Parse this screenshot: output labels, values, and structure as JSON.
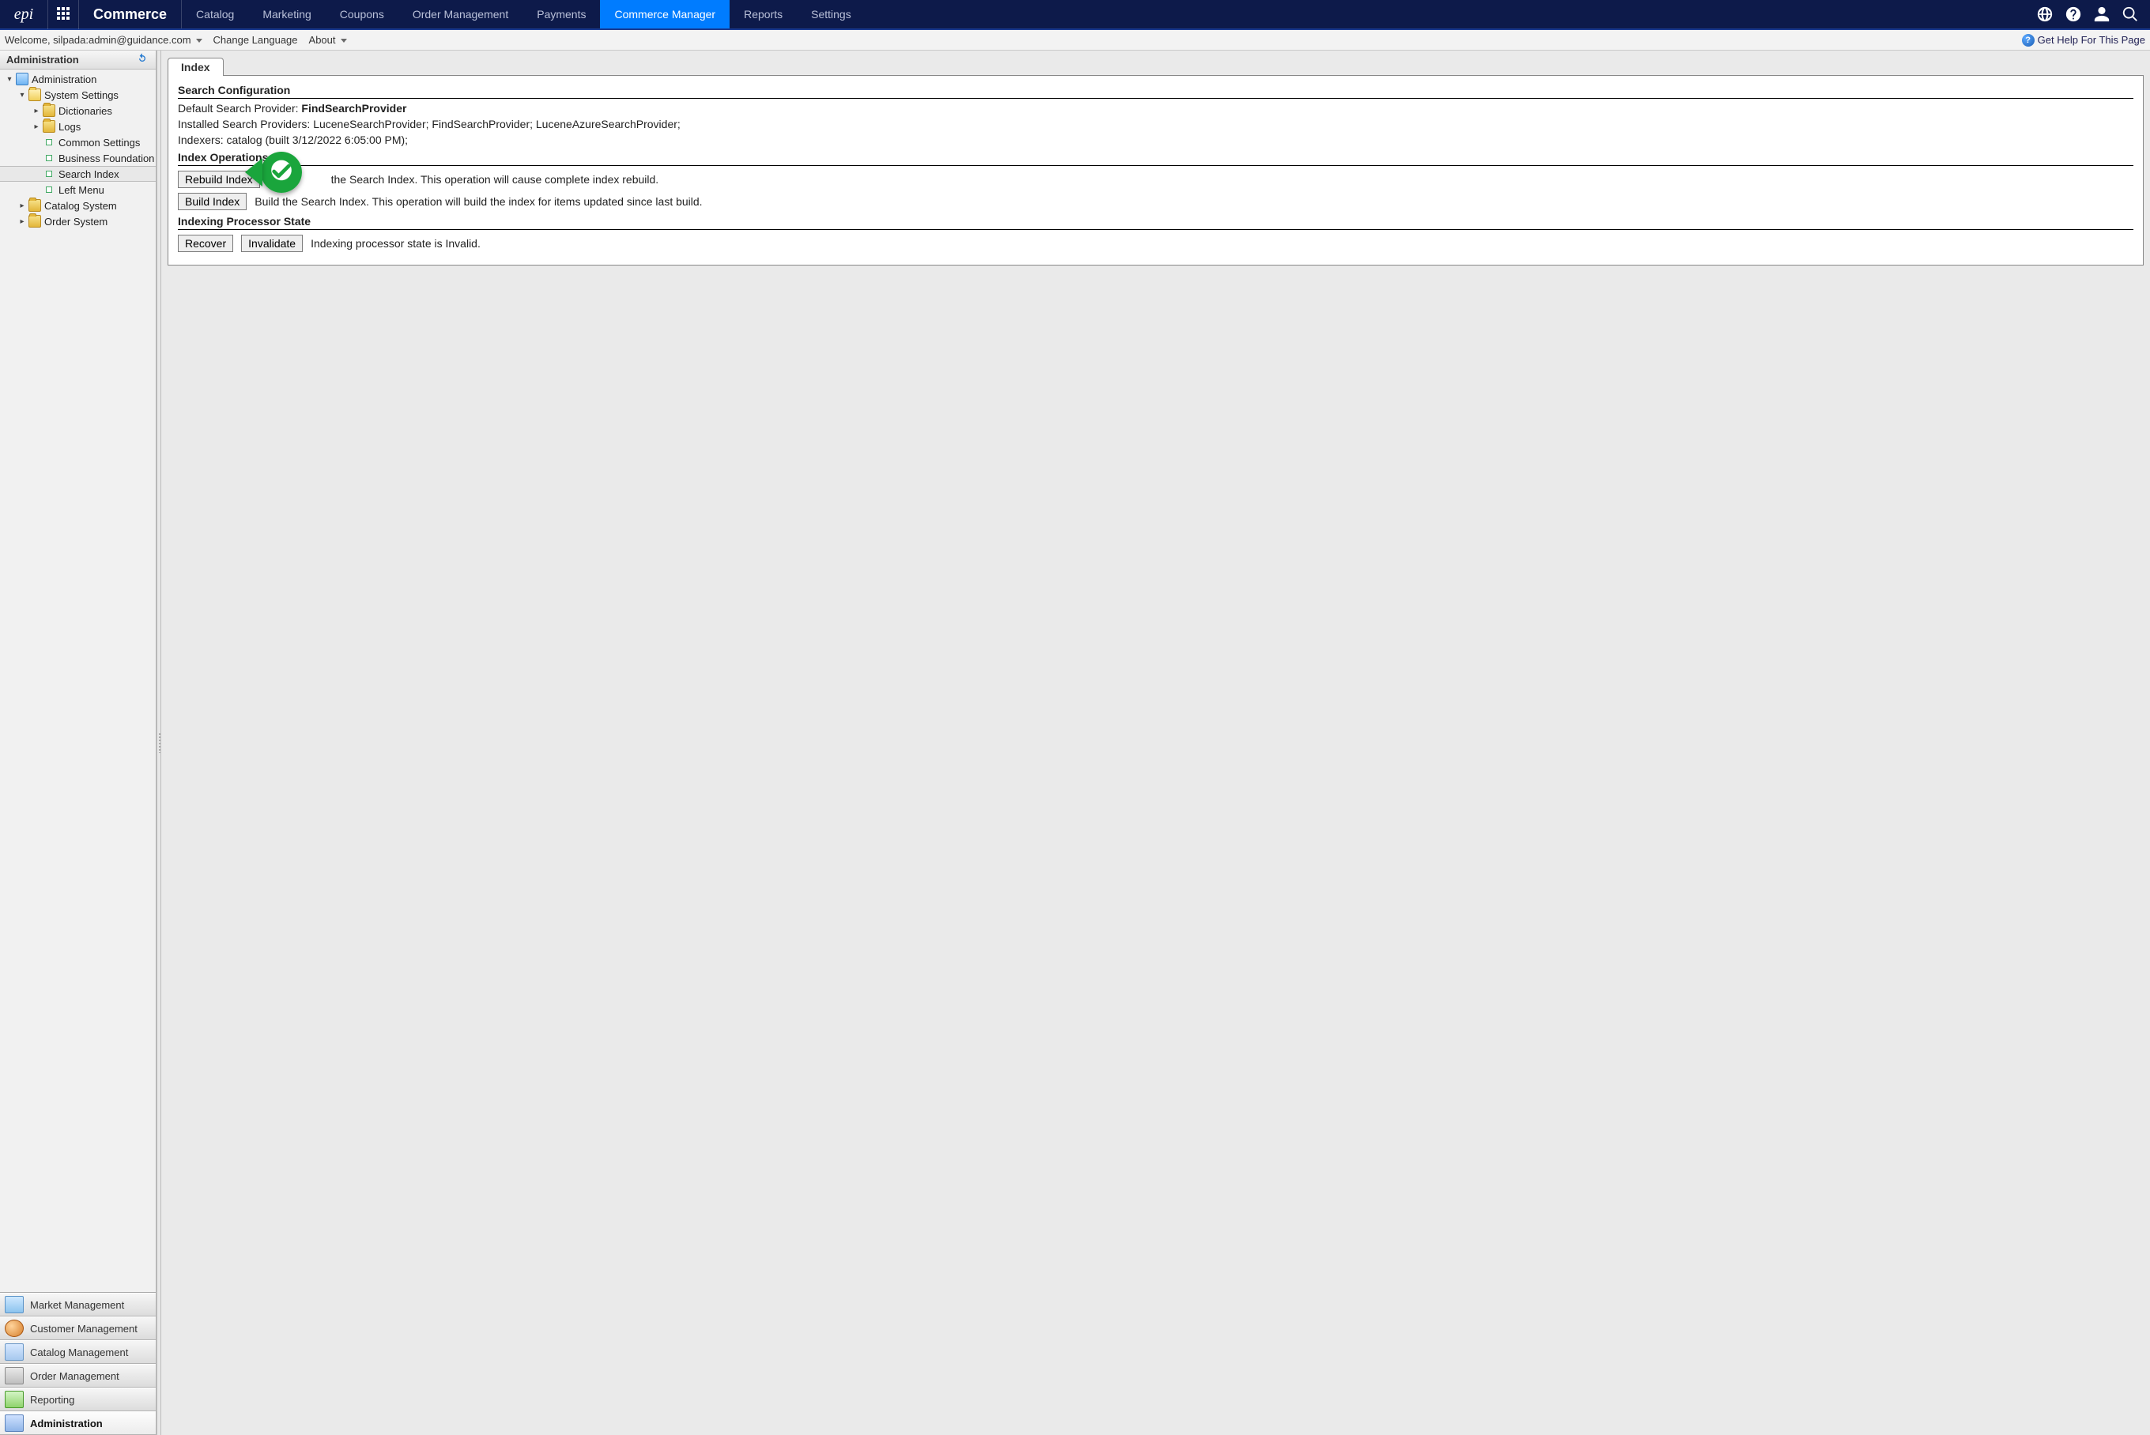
{
  "brand": "Commerce",
  "nav": [
    {
      "label": "Catalog",
      "active": false
    },
    {
      "label": "Marketing",
      "active": false
    },
    {
      "label": "Coupons",
      "active": false
    },
    {
      "label": "Order Management",
      "active": false
    },
    {
      "label": "Payments",
      "active": false
    },
    {
      "label": "Commerce Manager",
      "active": true
    },
    {
      "label": "Reports",
      "active": false
    },
    {
      "label": "Settings",
      "active": false
    }
  ],
  "subbar": {
    "welcome": "Welcome, silpada:admin@guidance.com",
    "change_language": "Change Language",
    "about": "About",
    "help": "Get Help For This Page"
  },
  "sidebar": {
    "header": "Administration",
    "tree": {
      "root": "Administration",
      "system_settings": "System Settings",
      "dictionaries": "Dictionaries",
      "logs": "Logs",
      "common_settings": "Common Settings",
      "business_foundation": "Business Foundation",
      "search_index": "Search Index",
      "left_menu": "Left Menu",
      "catalog_system": "Catalog System",
      "order_system": "Order System"
    },
    "bottom": [
      {
        "label": "Market Management",
        "cls": "market"
      },
      {
        "label": "Customer Management",
        "cls": "customer"
      },
      {
        "label": "Catalog Management",
        "cls": "catalog"
      },
      {
        "label": "Order Management",
        "cls": "order"
      },
      {
        "label": "Reporting",
        "cls": "report"
      },
      {
        "label": "Administration",
        "cls": "admin"
      }
    ]
  },
  "content": {
    "tab": "Index",
    "sections": {
      "search_config_title": "Search Configuration",
      "default_provider_label": "Default Search Provider: ",
      "default_provider_value": "FindSearchProvider",
      "installed_providers": "Installed Search Providers: LuceneSearchProvider; FindSearchProvider; LuceneAzureSearchProvider;",
      "indexers": "Indexers: catalog (built 3/12/2022 6:05:00 PM);",
      "index_ops_title": "Index Operations",
      "rebuild_btn": "Rebuild Index",
      "rebuild_desc": "the Search Index. This operation will cause complete index rebuild.",
      "build_btn": "Build Index",
      "build_desc": "Build the Search Index. This operation will build the index for items updated since last build.",
      "proc_state_title": "Indexing Processor State",
      "recover_btn": "Recover",
      "invalidate_btn": "Invalidate",
      "proc_state_desc": "Indexing processor state is Invalid."
    }
  }
}
